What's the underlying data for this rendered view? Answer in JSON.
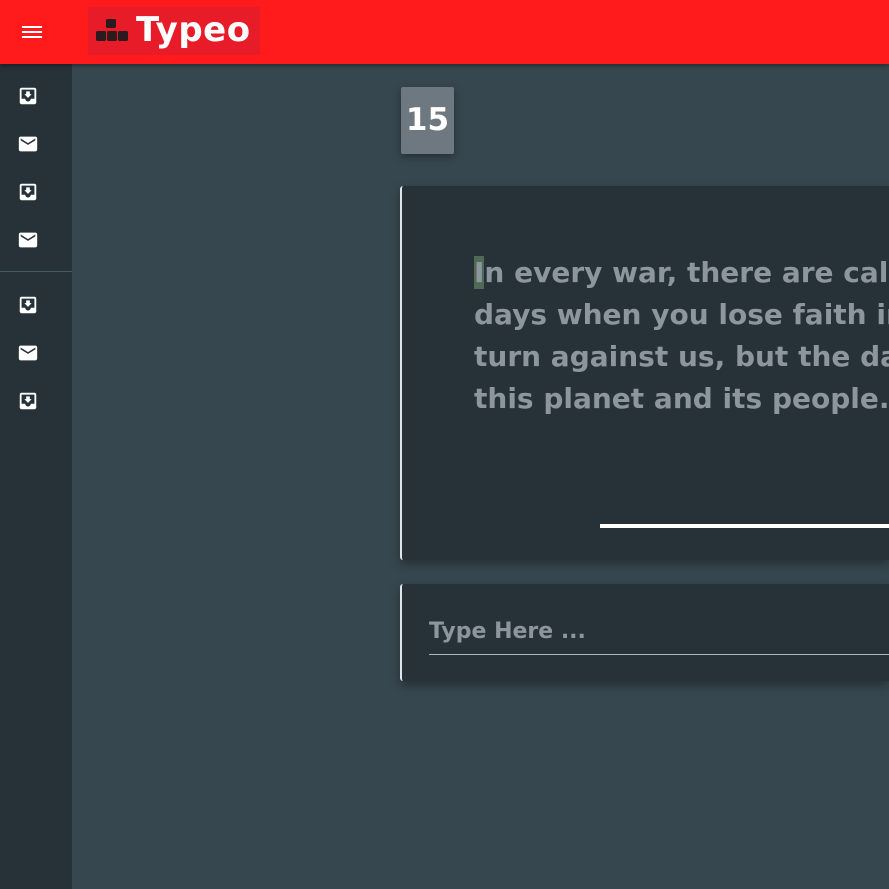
{
  "app": {
    "title": "Typeo",
    "brand_color": "#ff1a1c",
    "icons": {
      "menu": "menu-icon",
      "logo": "bricks-logo-icon",
      "nav": [
        "inbox-download-icon",
        "mail-icon",
        "inbox-download-icon",
        "mail-icon",
        "inbox-download-icon",
        "mail-icon",
        "inbox-download-icon"
      ]
    }
  },
  "counter": {
    "value": "15"
  },
  "passage": {
    "first_char": "I",
    "line1_rest": "n every war, there are calm",
    "line2": "days when you lose faith in",
    "line3": "turn against us, but the day",
    "line4": "this planet and its people."
  },
  "input": {
    "placeholder": "Type Here ..."
  }
}
